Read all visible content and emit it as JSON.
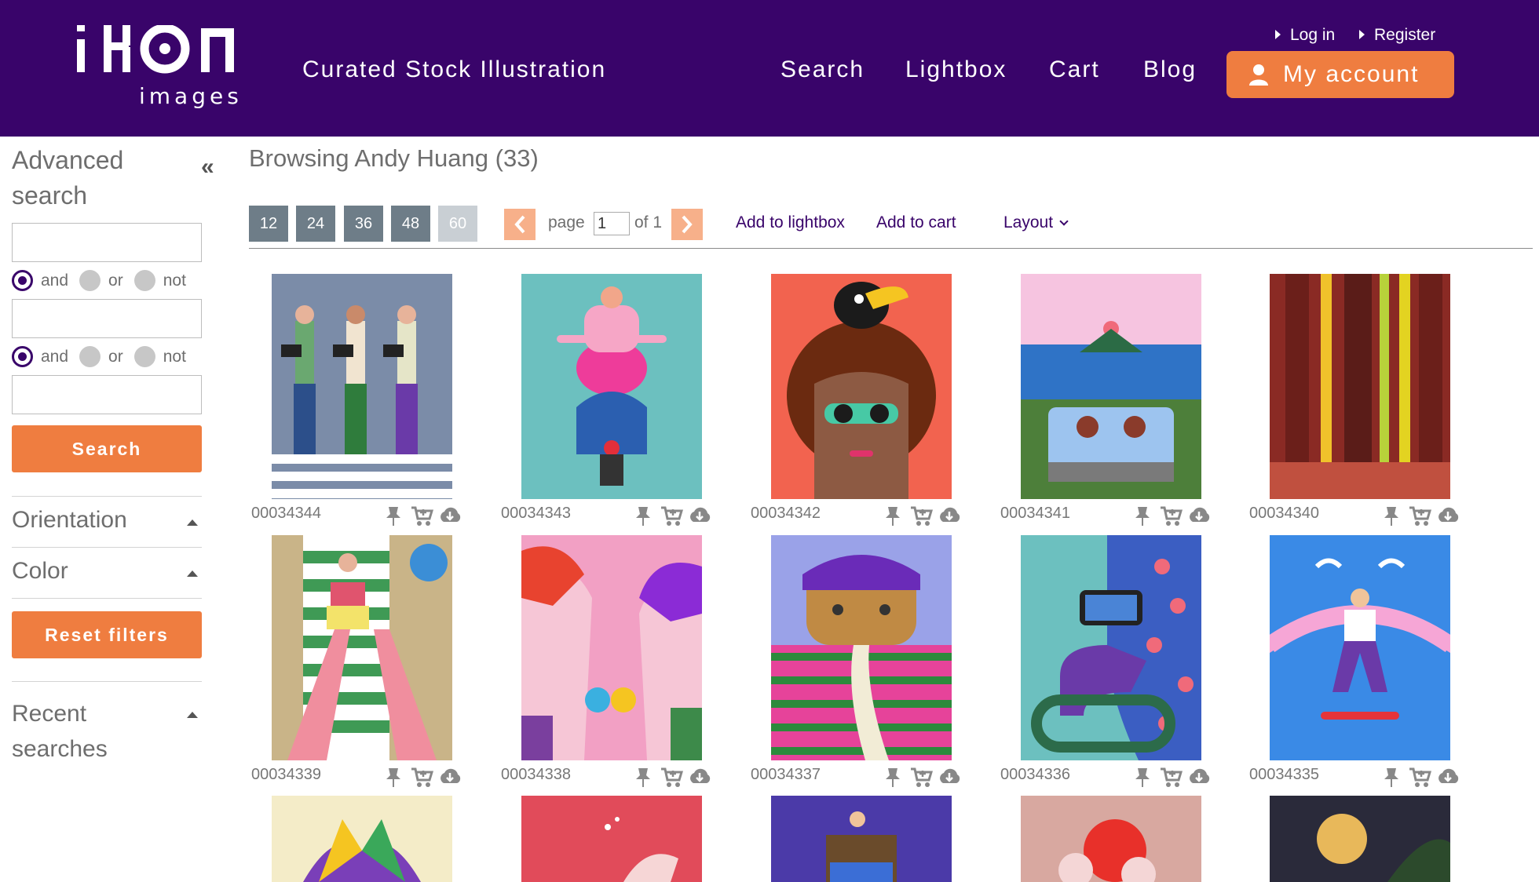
{
  "header": {
    "logo_text": "ikon",
    "logo_sub": "images",
    "tagline": "Curated Stock Illustration",
    "nav": [
      {
        "label": "Search"
      },
      {
        "label": "Lightbox"
      },
      {
        "label": "Cart"
      },
      {
        "label": "Blog"
      }
    ],
    "login_label": "Log in",
    "register_label": "Register",
    "account_label": "My account"
  },
  "sidebar": {
    "title": "Advanced search",
    "bool_row1": {
      "selected": "and",
      "options": [
        "and",
        "or",
        "not"
      ]
    },
    "bool_row2": {
      "selected": "and",
      "options": [
        "and",
        "or",
        "not"
      ]
    },
    "search_button": "Search",
    "orientation_label": "Orientation",
    "color_label": "Color",
    "reset_button": "Reset filters",
    "recent_label": "Recent searches"
  },
  "main": {
    "title": "Browsing Andy Huang (33)",
    "per_page": [
      "12",
      "24",
      "36",
      "48",
      "60"
    ],
    "per_page_selected": "60",
    "page_label": "page",
    "page_value": "1",
    "page_of": "of 1",
    "add_lightbox": "Add to lightbox",
    "add_cart": "Add to cart",
    "layout_label": "Layout",
    "images": [
      {
        "id": "00034344"
      },
      {
        "id": "00034343"
      },
      {
        "id": "00034342"
      },
      {
        "id": "00034341"
      },
      {
        "id": "00034340"
      },
      {
        "id": "00034339"
      },
      {
        "id": "00034338"
      },
      {
        "id": "00034337"
      },
      {
        "id": "00034336"
      },
      {
        "id": "00034335"
      }
    ]
  },
  "colors": {
    "header_bg": "#39046a",
    "accent": "#ef7d40",
    "perpage_bg": "#6e7d88"
  }
}
